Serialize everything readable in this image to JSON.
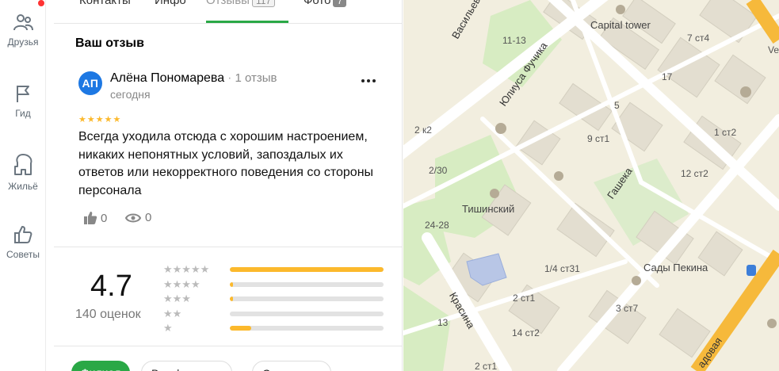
{
  "rail": {
    "items": [
      {
        "label": "Друзья",
        "icon": "friends-icon"
      },
      {
        "label": "Гид",
        "icon": "flag-icon"
      },
      {
        "label": "Жильё",
        "icon": "house-icon"
      },
      {
        "label": "Советы",
        "icon": "thumbs-up-icon"
      }
    ]
  },
  "tabs": [
    {
      "label": "Контакты"
    },
    {
      "label": "Инфо"
    },
    {
      "label": "Отзывы",
      "count": "117"
    },
    {
      "label": "Фото",
      "count": "7"
    }
  ],
  "review_section": {
    "title": "Ваш отзыв",
    "avatar_initials": "АП",
    "author": "Алёна Пономарева",
    "author_reviews": "1 отзыв",
    "date": "сегодня",
    "rating": 5,
    "text": "Всегда уходила отсюда с хорошим настроением, никаких непонятных условий, запоздалых их ответов или некорректного поведения со стороны персонала",
    "likes": "0",
    "views": "0"
  },
  "rating_summary": {
    "value": "4.7",
    "count_label": "140 оценок",
    "distribution": [
      {
        "stars": 5,
        "fraction": 1.0
      },
      {
        "stars": 4,
        "fraction": 0.02
      },
      {
        "stars": 3,
        "fraction": 0.02
      },
      {
        "stars": 2,
        "fraction": 0.0
      },
      {
        "stars": 1,
        "fraction": 0.14
      }
    ]
  },
  "filters": [
    {
      "label": "Филиал",
      "active": true
    },
    {
      "label": "Все филиалы",
      "active": false
    },
    {
      "label": "С ответами",
      "active": false
    }
  ],
  "map": {
    "labels": [
      {
        "text": "Capital tower"
      },
      {
        "text": "7 ст4"
      },
      {
        "text": "11-13"
      },
      {
        "text": "17"
      },
      {
        "text": "5"
      },
      {
        "text": "2 к2"
      },
      {
        "text": "9 ст1"
      },
      {
        "text": "1 ст2"
      },
      {
        "text": "2/30"
      },
      {
        "text": "12 ст2"
      },
      {
        "text": "Тишинский"
      },
      {
        "text": "24-28"
      },
      {
        "text": "1/4 ст31"
      },
      {
        "text": "Сады Пекина"
      },
      {
        "text": "2 ст1"
      },
      {
        "text": "3 ст7"
      },
      {
        "text": "13"
      },
      {
        "text": "14 ст2"
      },
      {
        "text": "2 ст1"
      },
      {
        "text": "Ve"
      }
    ],
    "streets": [
      {
        "text": "Васильев"
      },
      {
        "text": "Юлиуса Фучика"
      },
      {
        "text": "Гашека"
      },
      {
        "text": "Красина"
      },
      {
        "text": "адовая"
      }
    ],
    "colors": {
      "background": "#f2eedf",
      "park": "#d7ecc2",
      "building": "#e3ded0",
      "road": "#ffffff",
      "highway": "#f6b93b"
    }
  },
  "colors": {
    "accent_green": "#2aa846",
    "star_yellow": "#fcb92c",
    "avatar_blue": "#1d78e3"
  }
}
